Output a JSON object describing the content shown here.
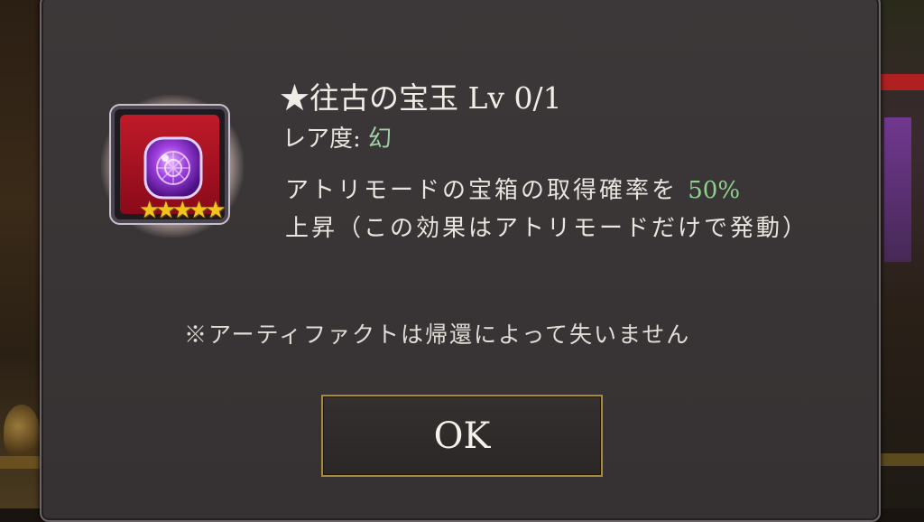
{
  "item": {
    "title": "★往古の宝玉 Lv 0/1",
    "rarity_label": "レア度: ",
    "rarity_value": "幻",
    "stars": "★★★★★",
    "description_prefix": "アトリモードの宝箱の取得確率を ",
    "description_percent": "50%",
    "description_suffix": "上昇（この効果はアトリモードだけで発動）",
    "icon": "purple-orb-icon"
  },
  "note": "※アーティファクトは帰還によって失いません",
  "buttons": {
    "ok_label": "OK"
  },
  "colors": {
    "dialog_bg": "#3a3637",
    "highlight_green": "#8fd08f",
    "button_border_gold": "#a88a3a",
    "icon_bg_red": "#b01424",
    "star_gold": "#f4c21c"
  }
}
